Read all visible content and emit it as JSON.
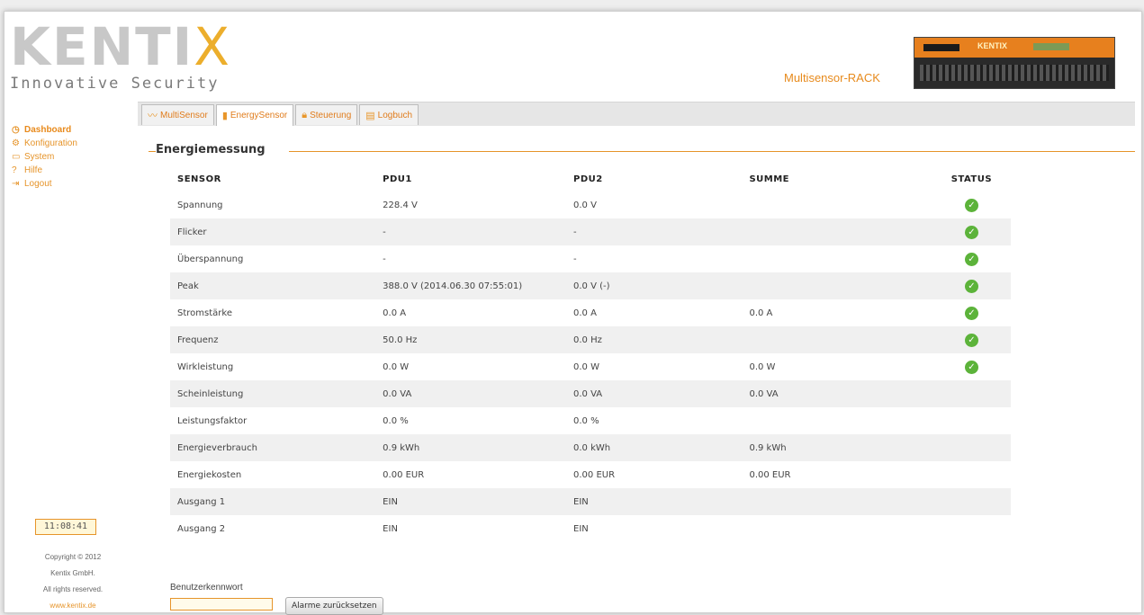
{
  "header": {
    "logo_text": "KENTIX",
    "logo_main": "KENTI",
    "logo_x": "X",
    "tagline": "Innovative Security",
    "product_name": "Multisensor-RACK",
    "device_label": "KENTIX"
  },
  "tabs": [
    {
      "label": "MultiSensor",
      "icon": "multisensor-icon"
    },
    {
      "label": "EnergySensor",
      "icon": "battery-icon",
      "active": true
    },
    {
      "label": "Steuerung",
      "icon": "lock-icon"
    },
    {
      "label": "Logbuch",
      "icon": "logbook-icon"
    }
  ],
  "sidebar": {
    "items": [
      {
        "label": "Dashboard",
        "icon": "dashboard-icon",
        "active": true
      },
      {
        "label": "Konfiguration",
        "icon": "gear-icon"
      },
      {
        "label": "System",
        "icon": "monitor-icon"
      },
      {
        "label": "Hilfe",
        "icon": "help-icon"
      },
      {
        "label": "Logout",
        "icon": "logout-icon"
      }
    ],
    "clock": "11:08:41"
  },
  "footer": {
    "copyright": "Copyright © 2012",
    "company": "Kentix GmbH.",
    "rights": "All rights reserved.",
    "website": "www.kentix.de"
  },
  "section": {
    "title": "Energiemessung"
  },
  "table": {
    "headers": [
      "SENSOR",
      "PDU1",
      "PDU2",
      "SUMME",
      "STATUS"
    ],
    "rows": [
      {
        "sensor": "Spannung",
        "pdu1": "228.4 V",
        "pdu2": "0.0 V",
        "summe": "",
        "status": "ok"
      },
      {
        "sensor": "Flicker",
        "pdu1": "-",
        "pdu2": "-",
        "summe": "",
        "status": "ok"
      },
      {
        "sensor": "Überspannung",
        "pdu1": "-",
        "pdu2": "-",
        "summe": "",
        "status": "ok"
      },
      {
        "sensor": "Peak",
        "pdu1": "388.0 V (2014.06.30 07:55:01)",
        "pdu2": "0.0 V (-)",
        "summe": "",
        "status": "ok"
      },
      {
        "sensor": "Stromstärke",
        "pdu1": "0.0 A",
        "pdu2": "0.0 A",
        "summe": "0.0 A",
        "status": "ok"
      },
      {
        "sensor": "Frequenz",
        "pdu1": "50.0 Hz",
        "pdu2": "0.0 Hz",
        "summe": "",
        "status": "ok"
      },
      {
        "sensor": "Wirkleistung",
        "pdu1": "0.0 W",
        "pdu2": "0.0 W",
        "summe": "0.0 W",
        "status": "ok"
      },
      {
        "sensor": "Scheinleistung",
        "pdu1": "0.0 VA",
        "pdu2": "0.0 VA",
        "summe": "0.0 VA",
        "status": ""
      },
      {
        "sensor": "Leistungsfaktor",
        "pdu1": "0.0 %",
        "pdu2": "0.0 %",
        "summe": "",
        "status": ""
      },
      {
        "sensor": "Energieverbrauch",
        "pdu1": "0.9 kWh",
        "pdu2": "0.0 kWh",
        "summe": "0.9 kWh",
        "status": ""
      },
      {
        "sensor": "Energiekosten",
        "pdu1": "0.00 EUR",
        "pdu2": "0.00 EUR",
        "summe": "0.00 EUR",
        "status": ""
      },
      {
        "sensor": "Ausgang 1",
        "pdu1": "EIN",
        "pdu2": "EIN",
        "summe": "",
        "status": ""
      },
      {
        "sensor": "Ausgang 2",
        "pdu1": "EIN",
        "pdu2": "EIN",
        "summe": "",
        "status": ""
      }
    ]
  },
  "password": {
    "label": "Benutzerkennwort",
    "value": "",
    "button_label": "Alarme zurücksetzen"
  },
  "colors": {
    "accent": "#e6942a",
    "status_ok": "#5cb33a"
  }
}
